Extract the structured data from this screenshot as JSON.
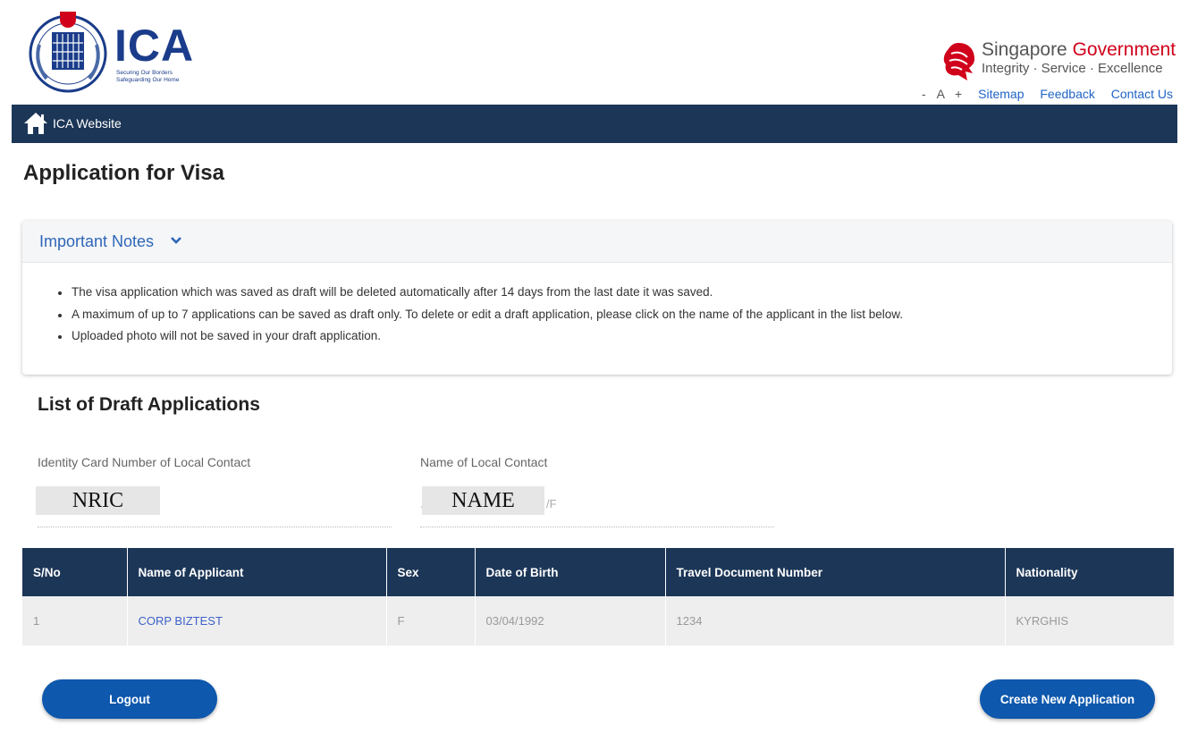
{
  "header": {
    "logo_text": "ICA",
    "logo_tagline_1": "Securing Our Borders",
    "logo_tagline_2": "Safeguarding Our Home",
    "gov_title_1": "Singapore ",
    "gov_title_2": "Government",
    "gov_motto": "Integrity · Service · Excellence",
    "font_decrease": "-",
    "font_label": "A",
    "font_increase": "+",
    "links": [
      "Sitemap",
      "Feedback",
      "Contact Us"
    ]
  },
  "nav": {
    "home_icon": "home-icon",
    "label": "ICA Website"
  },
  "page": {
    "title": "Application for Visa"
  },
  "notes": {
    "title": "Important Notes",
    "items": [
      "The visa application which was saved as draft will be deleted automatically after 14 days from the last date it was saved.",
      "A maximum of up to 7 applications can be saved as draft only. To delete or edit a draft application, please click on the name of the applicant in the list below.",
      "Uploaded photo will not be saved in your draft application."
    ]
  },
  "drafts": {
    "title": "List of Draft Applications",
    "id_label": "Identity Card Number of Local Contact",
    "id_value": "NRIC",
    "name_label": "Name of Local Contact",
    "name_value": "NAME",
    "name_prefix": ".",
    "name_suffix": "/F"
  },
  "table": {
    "headers": [
      "S/No",
      "Name of Applicant",
      "Sex",
      "Date of Birth",
      "Travel Document Number",
      "Nationality"
    ],
    "rows": [
      [
        "1",
        "CORP BIZTEST",
        "F",
        "03/04/1992",
        "1234",
        "KYRGHIS"
      ]
    ]
  },
  "buttons": {
    "logout": "Logout",
    "create": "Create New Application"
  },
  "colors": {
    "navy": "#1c3657",
    "button_blue": "#0e58ad",
    "link_blue": "#1f64c8",
    "gov_red": "#d0021b"
  }
}
